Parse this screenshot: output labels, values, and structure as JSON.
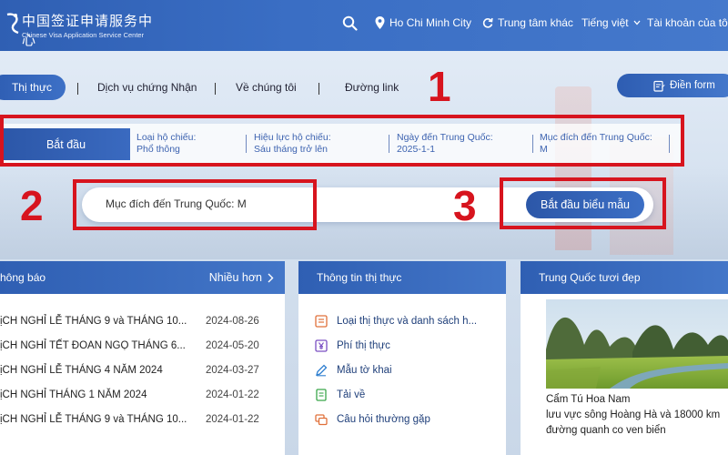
{
  "header": {
    "logo_cn": "中国签证申请服务中心",
    "logo_en": "Chinese Visa Application Service Center",
    "location": "Ho Chi Minh City",
    "other_centers": "Trung tâm khác",
    "language": "Tiếng việt",
    "account": "Tài khoản của tôi"
  },
  "nav": {
    "items": [
      "Thị thực",
      "Dịch vụ chứng Nhận",
      "Về chúng tôi",
      "Đường link"
    ],
    "fill_form": "Điền form"
  },
  "steps": {
    "start": "Bắt đầu",
    "items": [
      {
        "label": "Loại hộ chiếu:",
        "value": "Phổ thông"
      },
      {
        "label": "Hiệu lực hộ chiếu:",
        "value": "Sáu tháng trở lên"
      },
      {
        "label": "Ngày đến Trung Quốc:",
        "value": "2025-1-1"
      },
      {
        "label": "Mục đích đến Trung Quốc:",
        "value": "M"
      }
    ]
  },
  "search": {
    "value": "Mục đích đến Trung Quốc: M",
    "button": "Bắt đầu biểu mẫu"
  },
  "callouts": [
    "1",
    "2",
    "3"
  ],
  "notices": {
    "title": "hông báo",
    "more": "Nhiều hơn",
    "rows": [
      {
        "title": "ịCH NGHỈ LỄ THÁNG 9 và THÁNG 10...",
        "date": "2024-08-26"
      },
      {
        "title": "ịCH NGHỈ TẾT ĐOAN NGỌ THÁNG 6...",
        "date": "2024-05-20"
      },
      {
        "title": "ịCH NGHỈ LỄ THÁNG 4 NĂM 2024",
        "date": "2024-03-27"
      },
      {
        "title": "ịCH NGHỈ THÁNG 1 NĂM 2024",
        "date": "2024-01-22"
      },
      {
        "title": "ịCH NGHỈ LỄ THÁNG 9 và THÁNG 10...",
        "date": "2024-01-22"
      }
    ]
  },
  "visa_info": {
    "title": "Thông tin thị thực",
    "items": [
      {
        "label": "Loại thị thực và danh sách h...",
        "icon": "list-icon"
      },
      {
        "label": "Phí thị thực",
        "icon": "yen-icon"
      },
      {
        "label": "Mẫu tờ khai",
        "icon": "pen-icon"
      },
      {
        "label": "Tải về",
        "icon": "download-doc-icon"
      },
      {
        "label": "Câu hỏi thường gặp",
        "icon": "faq-icon"
      }
    ]
  },
  "china": {
    "title": "Trung Quốc tươi đẹp",
    "caption": "Cẩm Tú Hoa Nam",
    "desc_1": "lưu vực sông Hoàng Hà và 18000 km",
    "desc_2": "đường quanh co ven biển"
  },
  "colors": {
    "primary": "#2f5fb3",
    "accent_red": "#d7141e"
  }
}
